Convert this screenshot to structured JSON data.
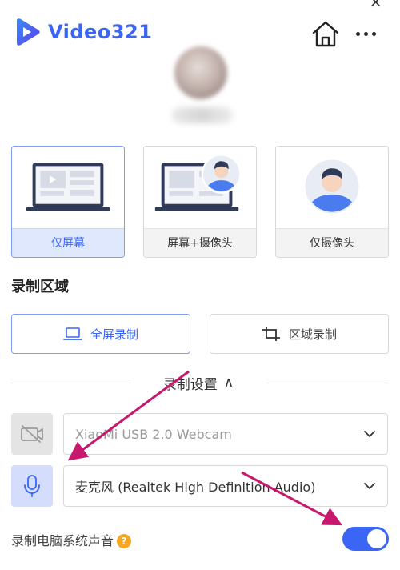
{
  "app": {
    "name": "Video321",
    "brand_color": "#3b66f5"
  },
  "header": {
    "close_glyph": "×",
    "home_icon": "home-icon",
    "more_icon": "more-icon"
  },
  "modes": [
    {
      "label": "仅屏幕",
      "selected": true
    },
    {
      "label": "屏幕+摄像头",
      "selected": false
    },
    {
      "label": "仅摄像头",
      "selected": false
    }
  ],
  "record_area": {
    "title": "录制区域",
    "options": [
      {
        "label": "全屏录制",
        "selected": true
      },
      {
        "label": "区域录制",
        "selected": false
      }
    ]
  },
  "settings": {
    "toggle_label": "录制设置",
    "toggle_glyph": "∧"
  },
  "devices": {
    "camera": {
      "value": "XiaoMi USB 2.0 Webcam",
      "enabled": false
    },
    "microphone": {
      "value": "麦克风 (Realtek High Definition Audio)",
      "enabled": true
    }
  },
  "system_audio": {
    "label": "录制电脑系统声音",
    "help_glyph": "?",
    "enabled": true
  },
  "annotation_color": "#c8186e"
}
